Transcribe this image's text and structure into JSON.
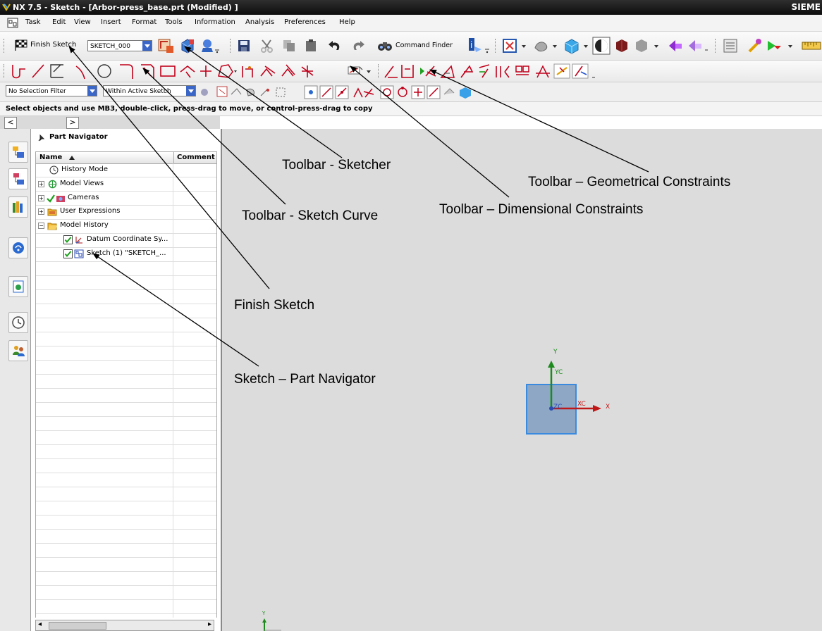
{
  "window": {
    "title": "NX 7.5 - Sketch - [Arbor-press_base.prt (Modified) ]",
    "brand": "SIEME"
  },
  "menu": {
    "items": [
      "Task",
      "Edit",
      "View",
      "Insert",
      "Format",
      "Tools",
      "Information",
      "Analysis",
      "Preferences",
      "Help"
    ]
  },
  "toolbar": {
    "finish_sketch": "Finish Sketch",
    "sketch_name": "SKETCH_000",
    "command_finder": "Command Finder"
  },
  "selection_bar": {
    "filter": "No Selection Filter",
    "scope": "Within Active Sketch"
  },
  "status": {
    "text": "Select objects and use MB3, double-click, press-drag to move, or control-press-drag to copy"
  },
  "part_navigator": {
    "title": "Part Navigator",
    "col_name": "Name",
    "col_comment": "Comment",
    "items": [
      {
        "label": "History Mode"
      },
      {
        "label": "Model Views"
      },
      {
        "label": "Cameras"
      },
      {
        "label": "User Expressions"
      },
      {
        "label": "Model History"
      },
      {
        "label": "Datum Coordinate Sy..."
      },
      {
        "label": "Sketch (1) \"SKETCH_..."
      }
    ]
  },
  "canvas": {
    "axis_x": "X",
    "axis_y": "Y",
    "axis_xc": "XC",
    "axis_yc": "YC",
    "axis_zc": "ZC",
    "small_y": "Y"
  },
  "annotations": {
    "sketcher": "Toolbar - Sketcher",
    "geometrical": "Toolbar – Geometrical Constraints",
    "dimensional": "Toolbar – Dimensional Constraints",
    "sketch_curve": "Toolbar - Sketch  Curve",
    "finish_sketch": "Finish Sketch",
    "part_navigator": "Sketch – Part Navigator"
  }
}
